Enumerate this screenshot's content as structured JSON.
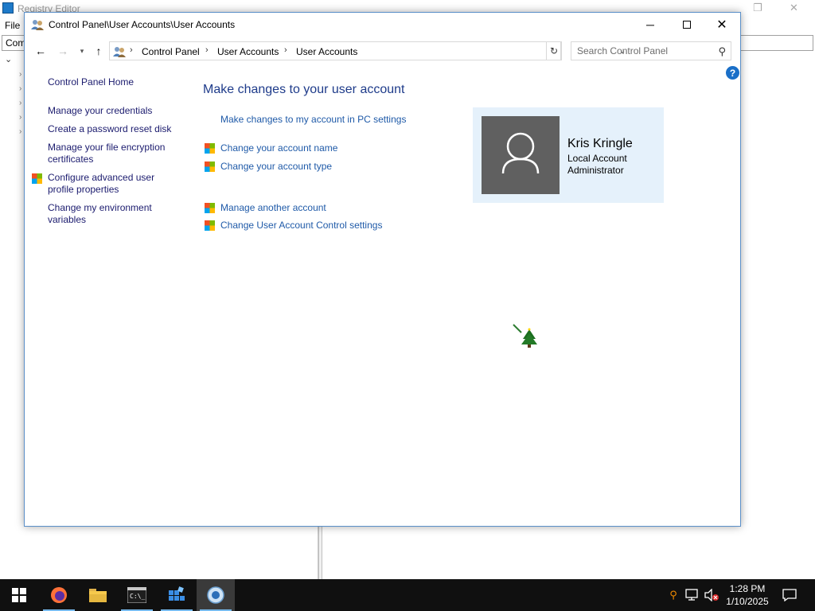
{
  "background_app": {
    "title": "Registry Editor",
    "menu_file": "File",
    "address_value": "Com"
  },
  "window": {
    "title": "Control Panel\\User Accounts\\User Accounts",
    "breadcrumbs": [
      "Control Panel",
      "User Accounts",
      "User Accounts"
    ],
    "search_placeholder": "Search Control Panel"
  },
  "left_pane": {
    "home": "Control Panel Home",
    "links": [
      "Manage your credentials",
      "Create a password reset disk",
      "Manage your file encryption certificates",
      "Configure advanced user profile properties",
      "Change my environment variables"
    ]
  },
  "main": {
    "heading": "Make changes to your user account",
    "pc_settings_link": "Make changes to my account in PC settings",
    "links": [
      "Change your account name",
      "Change your account type",
      "Manage another account",
      "Change User Account Control settings"
    ]
  },
  "account": {
    "name": "Kris Kringle",
    "type": "Local Account",
    "role": "Administrator"
  },
  "taskbar": {
    "time": "1:28 PM",
    "date": "1/10/2025"
  },
  "colors": {
    "link": "#1f5aa8",
    "heading": "#1e3b8a",
    "card_bg": "#e5f1fb",
    "avatar_bg": "#606060",
    "taskbar": "#101010"
  }
}
